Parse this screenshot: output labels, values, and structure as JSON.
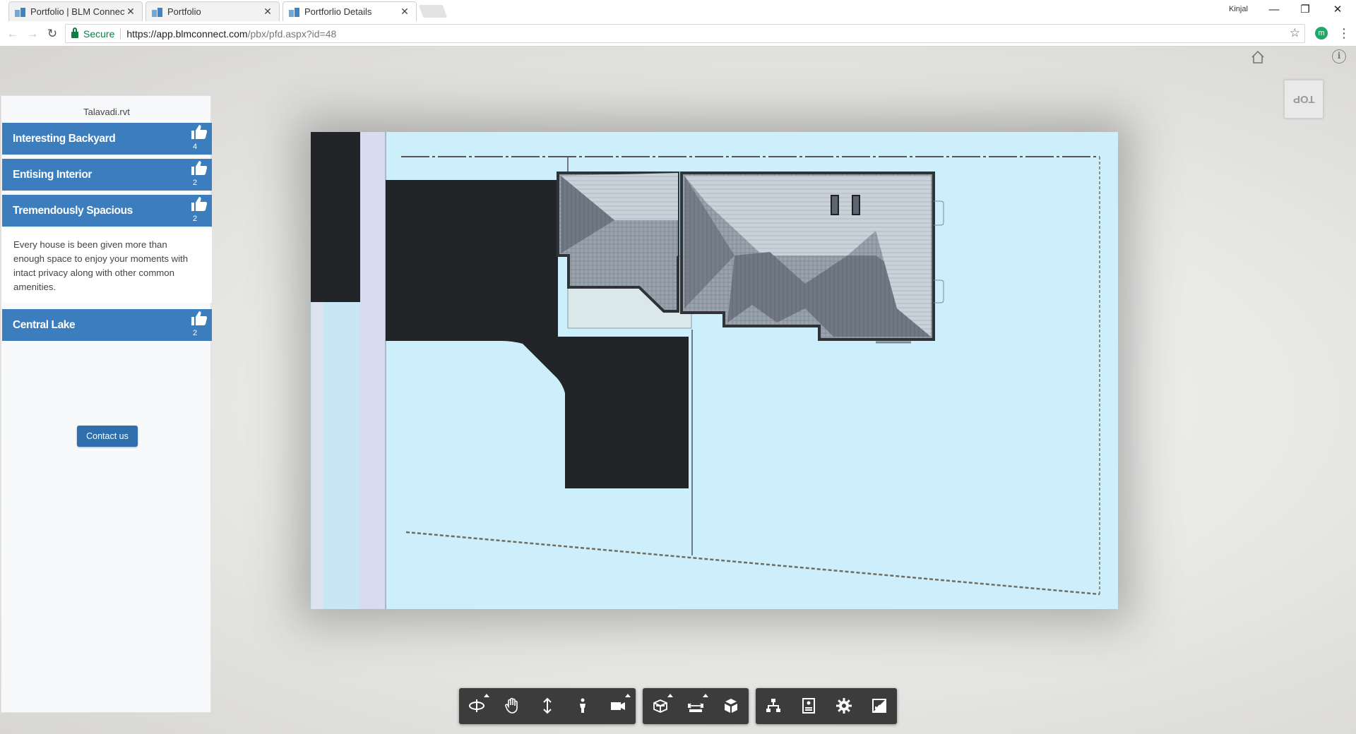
{
  "browser": {
    "tabs": [
      {
        "title": "Portfolio | BLM Connect",
        "active": false
      },
      {
        "title": "Portfolio",
        "active": false
      },
      {
        "title": "Portforlio Details",
        "active": true
      }
    ],
    "profile_name": "Kinjal",
    "address": {
      "secure_label": "Secure",
      "url_host": "https://app.blmconnect.com",
      "url_path": "/pbx/pfd.aspx?id=48"
    },
    "extension_letter": "m"
  },
  "viewer": {
    "viewcube_label": "TOP",
    "sidebar": {
      "file_name": "Talavadi.rvt",
      "features": [
        {
          "label": "Interesting Backyard",
          "likes": "4"
        },
        {
          "label": "Entising Interior",
          "likes": "2"
        },
        {
          "label": "Tremendously Spacious",
          "likes": "2",
          "description": "Every house is been given more than enough space to enjoy your moments with intact privacy along with other common amenities."
        },
        {
          "label": "Central Lake",
          "likes": "2"
        }
      ],
      "contact_label": "Contact us"
    },
    "toolbar_groups": [
      [
        "orbit-icon",
        "pan-icon",
        "zoom-icon",
        "first-person-icon",
        "camera-icon"
      ],
      [
        "section-icon",
        "measure-icon",
        "explode-icon"
      ],
      [
        "model-browser-icon",
        "properties-icon",
        "settings-icon",
        "fullscreen-icon"
      ]
    ],
    "colors": {
      "feature_bar": "#3b7dbd",
      "site_ground": "#cdeefb",
      "driveway": "#222427",
      "toolbar": "#3c3c3c"
    }
  }
}
